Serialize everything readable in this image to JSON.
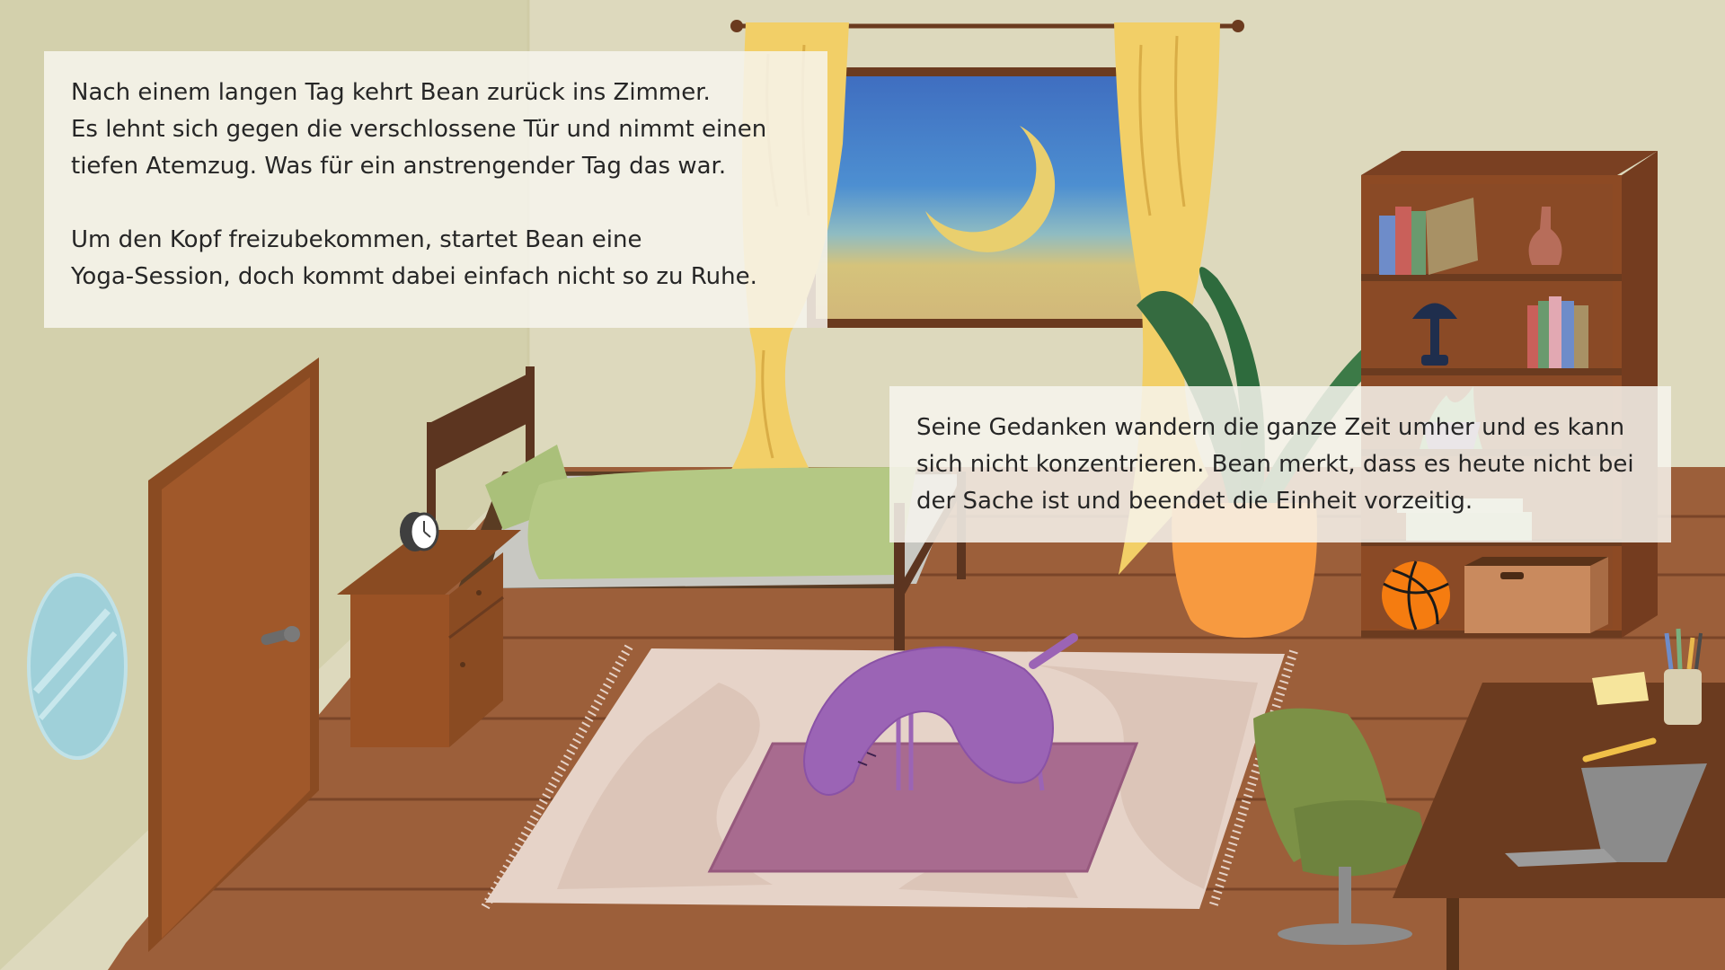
{
  "story": {
    "box1": {
      "para1": [
        "Nach einem langen Tag kehrt Bean zurück ins Zimmer.",
        "Es lehnt sich gegen die verschlossene Tür und nimmt einen",
        "tiefen Atemzug. Was für ein anstrengender Tag das war."
      ],
      "para2": [
        "Um den Kopf freizubekommen, startet Bean eine",
        "Yoga-Session, doch kommt dabei einfach nicht so zu Ruhe."
      ]
    },
    "box2": {
      "lines": [
        "Seine Gedanken wandern die ganze Zeit umher und es kann",
        "sich nicht konzentrieren. Bean merkt, dass es heute nicht bei",
        "der Sache ist und beendet die Einheit vorzeitig."
      ]
    }
  },
  "colors": {
    "wall": "#ddd9bd",
    "wall_shadow": "#d3d0ac",
    "floor": "#9c5f3a",
    "floor_line": "#7a4528",
    "curtain": "#f2cf67",
    "bean": "#9b64b5",
    "yoga_mat": "#a86b8f",
    "rug": "#e6d3c8",
    "plant_pot": "#f79a40",
    "chair": "#7c9146"
  },
  "icons": {
    "alarm_clock": "alarm-clock-icon",
    "moon": "crescent-moon-icon",
    "basketball": "basketball-icon",
    "laptop": "laptop-icon"
  }
}
